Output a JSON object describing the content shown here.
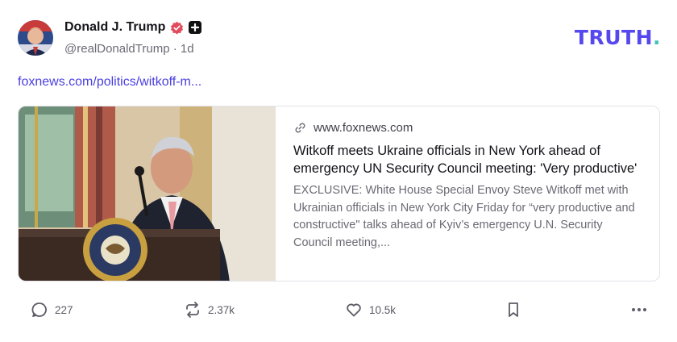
{
  "author": {
    "name": "Donald J. Trump",
    "handle": "@realDonaldTrump",
    "time": "1d",
    "separator": "·"
  },
  "brand": {
    "logo_text": "TRUTH",
    "logo_dot": ".",
    "accent": "#5448ee",
    "dot_color": "#41c3b6"
  },
  "post": {
    "link_text": "foxnews.com/politics/witkoff-m..."
  },
  "card": {
    "domain": "www.foxnews.com",
    "headline": "Witkoff meets Ukraine officials in New York ahead of emergency UN Security Council meeting: 'Very productive'",
    "description": "EXCLUSIVE: White House Special Envoy Steve Witkoff met with Ukrainian officials in New York City Friday for “very productive and constructive\" talks ahead of Kyiv’s emergency U.N. Security Council meeting,..."
  },
  "actions": {
    "replies": "227",
    "retruths": "2.37k",
    "likes": "10.5k"
  },
  "icons": [
    "verified-icon",
    "plus-badge-icon",
    "link-icon",
    "reply-icon",
    "retruth-icon",
    "like-icon",
    "bookmark-icon",
    "more-icon"
  ]
}
